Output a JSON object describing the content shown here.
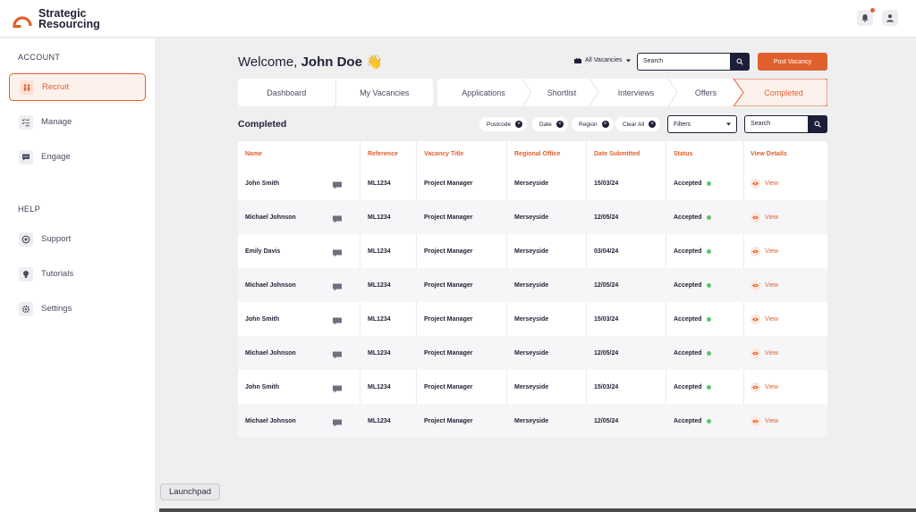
{
  "brand": {
    "line1": "Strategic",
    "line2": "Resourcing",
    "accent": "#e0602d",
    "navy": "#1d1f3a"
  },
  "topbar": {
    "icons": [
      "bell-icon",
      "user-icon"
    ]
  },
  "sidebar": {
    "account_heading": "ACCOUNT",
    "help_heading": "HELP",
    "account_items": [
      {
        "label": "Recruit",
        "icon": "people-icon",
        "active": true
      },
      {
        "label": "Manage",
        "icon": "checklist-icon",
        "active": false
      },
      {
        "label": "Engage",
        "icon": "chat-icon",
        "active": false
      }
    ],
    "help_items": [
      {
        "label": "Support",
        "icon": "support-icon"
      },
      {
        "label": "Tutorials",
        "icon": "lightbulb-icon"
      },
      {
        "label": "Settings",
        "icon": "gear-icon"
      }
    ]
  },
  "header": {
    "welcome": "Welcome,",
    "user": "John Doe",
    "wave": "👋",
    "vacancy_select": "All Vacancies",
    "search_placeholder": "Search",
    "post_button": "Post Vacancy"
  },
  "tabs": {
    "group1": [
      "Dashboard",
      "My Vacancies"
    ],
    "group2": [
      "Applications",
      "Shortlist",
      "Interviews",
      "Offers",
      "Completed"
    ],
    "active": "Completed"
  },
  "filters": {
    "title": "Completed",
    "chips": [
      "Postcode",
      "Date",
      "Region",
      "Clear All"
    ],
    "filters_label": "Filters",
    "search_placeholder": "Search"
  },
  "table": {
    "columns": [
      "Name",
      "Reference",
      "Vacancy Title",
      "Regional Office",
      "Date Submitted",
      "Status",
      "View Details"
    ],
    "rows": [
      {
        "name": "John Smith",
        "reference": "ML1234",
        "title": "Project Manager",
        "office": "Merseyside",
        "date": "15/03/24",
        "status": "Accepted",
        "view": "View"
      },
      {
        "name": "Michael Johnson",
        "reference": "ML1234",
        "title": "Project Manager",
        "office": "Merseyside",
        "date": "12/05/24",
        "status": "Accepted",
        "view": "View"
      },
      {
        "name": "Emily Davis",
        "reference": "ML1234",
        "title": "Project Manager",
        "office": "Merseyside",
        "date": "03/04/24",
        "status": "Accepted",
        "view": "View"
      },
      {
        "name": "Michael Johnson",
        "reference": "ML1234",
        "title": "Project Manager",
        "office": "Merseyside",
        "date": "12/05/24",
        "status": "Accepted",
        "view": "View"
      },
      {
        "name": "John Smith",
        "reference": "ML1234",
        "title": "Project Manager",
        "office": "Merseyside",
        "date": "15/03/24",
        "status": "Accepted",
        "view": "View"
      },
      {
        "name": "Michael Johnson",
        "reference": "ML1234",
        "title": "Project Manager",
        "office": "Merseyside",
        "date": "12/05/24",
        "status": "Accepted",
        "view": "View"
      },
      {
        "name": "John Smith",
        "reference": "ML1234",
        "title": "Project Manager",
        "office": "Merseyside",
        "date": "15/03/24",
        "status": "Accepted",
        "view": "View"
      },
      {
        "name": "Michael Johnson",
        "reference": "ML1234",
        "title": "Project Manager",
        "office": "Merseyside",
        "date": "12/05/24",
        "status": "Accepted",
        "view": "View"
      }
    ]
  },
  "dock": {
    "tooltip": "Launchpad"
  }
}
